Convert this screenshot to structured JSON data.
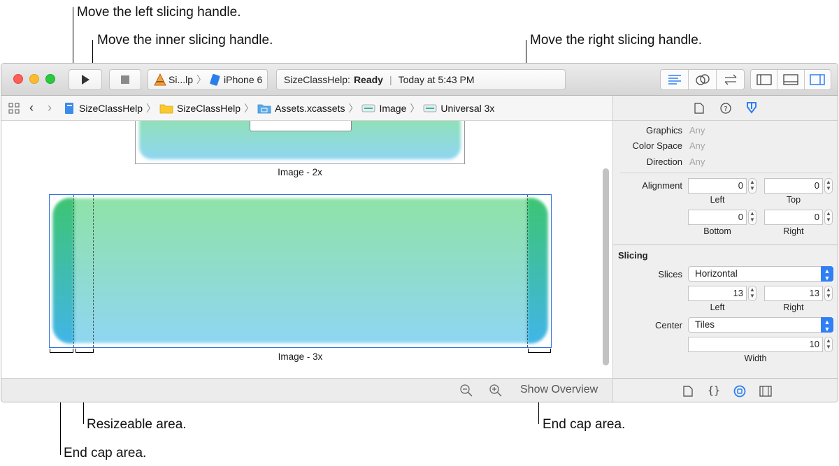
{
  "callouts": {
    "left_handle": "Move the left slicing handle.",
    "inner_handle": "Move the inner slicing handle.",
    "right_handle": "Move the right slicing handle.",
    "resizeable": "Resizeable area.",
    "end_cap_right": "End cap area.",
    "end_cap_left": "End cap area."
  },
  "toolbar": {
    "scheme_label": "Si...lp",
    "device_label": "iPhone 6",
    "status_app": "SizeClassHelp:",
    "status_state": "Ready",
    "status_time": "Today at 5:43 PM",
    "icons": [
      "run-icon",
      "stop-icon",
      "standard-editor-icon",
      "assistant-editor-icon",
      "version-editor-icon",
      "navigator-toggle-icon",
      "debug-area-toggle-icon",
      "utilities-toggle-icon"
    ]
  },
  "jumpbar": {
    "crumbs": [
      {
        "label": "SizeClassHelp",
        "icon": "project-icon"
      },
      {
        "label": "SizeClassHelp",
        "icon": "folder-icon"
      },
      {
        "label": "Assets.xcassets",
        "icon": "asset-catalog-icon"
      },
      {
        "label": "Image",
        "icon": "image-set-icon"
      },
      {
        "label": "Universal 3x",
        "icon": "image-slot-icon"
      }
    ]
  },
  "canvas": {
    "image_2x_label": "Image - 2x",
    "image_3x_label": "Image - 3x"
  },
  "bottom_bar": {
    "show_overview": "Show Overview"
  },
  "inspector": {
    "properties": [
      {
        "label": "Graphics",
        "value": "Any"
      },
      {
        "label": "Color Space",
        "value": "Any"
      },
      {
        "label": "Direction",
        "value": "Any"
      }
    ],
    "alignment": {
      "label": "Alignment",
      "left": "0",
      "left_label": "Left",
      "top": "0",
      "top_label": "Top",
      "bottom": "0",
      "bottom_label": "Bottom",
      "right": "0",
      "right_label": "Right"
    },
    "slicing": {
      "section": "Slicing",
      "slices_label": "Slices",
      "slices_value": "Horizontal",
      "left": "13",
      "left_label": "Left",
      "right": "13",
      "right_label": "Right",
      "center_label": "Center",
      "center_value": "Tiles",
      "width": "10",
      "width_label": "Width"
    }
  },
  "colors": {
    "accent": "#2f7ff5",
    "close": "#fc5f57",
    "minimize": "#fdbc2e",
    "zoom": "#29c940",
    "gradient_top": "#8fe3a8",
    "gradient_bottom": "#8fd6f2"
  }
}
